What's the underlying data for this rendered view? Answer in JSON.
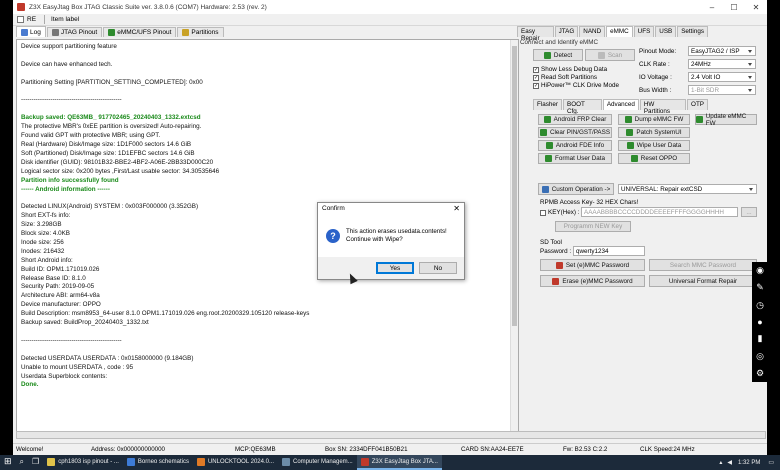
{
  "window": {
    "title": "Z3X EasyJtag Box JTAG Classic Suite ver. 3.8.0.6 (COM7) Hardware: 2.53 (rev. 2)"
  },
  "toolbar": {
    "re_label": "RE",
    "item_label": "Item label"
  },
  "left_tabs": [
    "Log",
    "JTAG Pinout",
    "eMMC/UFS Pinout",
    "Partitions"
  ],
  "log_lines": [
    {
      "t": "Device support partitioning feature",
      "s": "n"
    },
    {
      "t": "",
      "s": "n"
    },
    {
      "t": "Device can have enhanced tech.",
      "s": "n"
    },
    {
      "t": "",
      "s": "n"
    },
    {
      "t": "Partitioning Setting [PARTITION_SETTING_COMPLETED]: 0x00",
      "s": "n"
    },
    {
      "t": "",
      "s": "n"
    },
    {
      "t": "------------------------------------------------",
      "s": "n"
    },
    {
      "t": "",
      "s": "n"
    },
    {
      "t": "Backup saved: QE63MB_ 917702465_20240403_1332.extcsd",
      "s": "g"
    },
    {
      "t": "The protective MBR's 0xEE partition is oversized! Auto-repairing.",
      "s": "n"
    },
    {
      "t": "Found valid GPT with protective MBR; using GPT.",
      "s": "n"
    },
    {
      "t": "Real (Hardware) Disk/Image size: 1D1F000 sectors 14.6 GiB",
      "s": "n"
    },
    {
      "t": "Soft (Partitioned) Disk/Image size: 1D1EFBC sectors 14.6 GiB",
      "s": "n"
    },
    {
      "t": "Disk identifier (GUID): 98101B32-BBE2-4BF2-A06E-2BB33D000C20",
      "s": "n"
    },
    {
      "t": "Logical sector size: 0x200  bytes ,First/Last usable sector: 34.30535646",
      "s": "n"
    },
    {
      "t": "Partition info successfully found",
      "s": "g"
    },
    {
      "t": "------ Android information ------",
      "s": "g"
    },
    {
      "t": "",
      "s": "n"
    },
    {
      "t": "Detected LINUX(Android) SYSTEM : 0x003F000000 (3.352GB)",
      "s": "n"
    },
    {
      "t": "Short EXT-fs info:",
      "s": "n"
    },
    {
      "t": "Size: 3.298GB",
      "s": "n"
    },
    {
      "t": "Block size: 4.0KB",
      "s": "n"
    },
    {
      "t": "Inode size: 256",
      "s": "n"
    },
    {
      "t": "Inodes: 216432",
      "s": "n"
    },
    {
      "t": "Short Android info:",
      "s": "n"
    },
    {
      "t": "Build ID: OPM1.171019.026",
      "s": "b"
    },
    {
      "t": "Release Base ID: 8.1.0",
      "s": "b"
    },
    {
      "t": "Security Path: 2019-09-05",
      "s": "b"
    },
    {
      "t": "Architecture ABI: arm64-v8a",
      "s": "b"
    },
    {
      "t": "Device manufacturer: OPPO",
      "s": "b"
    },
    {
      "t": "Build Description: msm8953_64-user 8.1.0 OPM1.171019.026 eng.root.20200329.105120 release-keys",
      "s": "b"
    },
    {
      "t": "Backup saved: BuildProp_20240403_1332.txt",
      "s": "n"
    },
    {
      "t": "",
      "s": "n"
    },
    {
      "t": "------------------------------------------------",
      "s": "n"
    },
    {
      "t": "",
      "s": "n"
    },
    {
      "t": "Detected USERDATA USERDATA : 0x0158000000 (9.184GB)",
      "s": "n"
    },
    {
      "t": "Unable to mount USERDATA , code : 95",
      "s": "n"
    },
    {
      "t": "Userdata Superblock contents:",
      "s": "n"
    },
    {
      "t": "Done.",
      "s": "g"
    }
  ],
  "right_tabs": [
    "Easy Repair",
    "JTAG",
    "NAND",
    "eMMC",
    "UFS",
    "USB",
    "Settings"
  ],
  "connect": {
    "group_label": "Connect and Identify eMMC",
    "detect": "Detect",
    "scan": "Scan",
    "pinout_mode_label": "Pinout Mode:",
    "pinout_mode": "EasyJTAG2 / ISP",
    "clk_rate_label": "CLK Rate :",
    "clk_rate": "24MHz",
    "io_voltage_label": "IO Voltage :",
    "io_voltage": "2.4 Volt IO",
    "bus_width_label": "Bus Width :",
    "bus_width": "1-Bit SDR",
    "opt1": "Show Less Debug Data",
    "opt2": "Read Soft Partitions",
    "opt3": "HiPower™ CLK Drive Mode"
  },
  "sub_tabs": [
    "Flasher",
    "BOOT Cfg.",
    "Advanced",
    "HW Partitions",
    "OTP"
  ],
  "advanced": {
    "android_frp": "Android FRP Clear",
    "dump_emmc": "Dump eMMC FW",
    "update_emmc": "Update eMMC FW",
    "clear_pin": "Clear PIN/GST/PASS",
    "patch_systemui": "Patch SystemUI",
    "android_fde": "Android FDE Info",
    "wipe_user": "Wipe User Data",
    "format_user": "Format User Data",
    "reset_oppo": "Reset OPPO",
    "custom_op": "Custom Operation ->",
    "custom_select": "UNIVERSAL: Repair extCSD"
  },
  "rpmb": {
    "label": "RPMB Access Key- 32 HEX Chars!",
    "key_label": "KEY(Hex) :",
    "key_value": "AAAABBBBCCCCDDDDEEEEFFFFGGGGHHHH",
    "program_new_key": "Programm NEW Key"
  },
  "sd": {
    "label": "SD Tool",
    "password_label": "Password :",
    "password": "qwerty1234",
    "set_pwd": "Set (e)MMC Password",
    "search_pwd": "Search MMC Password",
    "erase_pwd": "Erase (e)MMC Password",
    "universal_format": "Universal Format Repair"
  },
  "dialog": {
    "title": "Confirm",
    "line1": "This action erases usedata.contents!",
    "line2": "Continue with Wipe?",
    "yes": "Yes",
    "no": "No"
  },
  "status": {
    "welcome": "Welcome!",
    "address": "Address: 0x000000000000",
    "mcp": "MCP:QE63MB",
    "box_sn": "Box SN: 2334DFF041B50B21",
    "card_sn": "CARD SN:AA24-EE7E",
    "fw": "Fw: B2.53 C:2.2",
    "clk": "CLK Speed:24 MHz"
  },
  "taskbar": {
    "items": [
      "cph1803 isp pinout - ...",
      "Borneo schematics",
      "UNLOCKTOOL 2024.0...",
      "Computer Managem...",
      "Z3X EasyJtag Box JTA..."
    ],
    "time": "1:32 PM"
  }
}
